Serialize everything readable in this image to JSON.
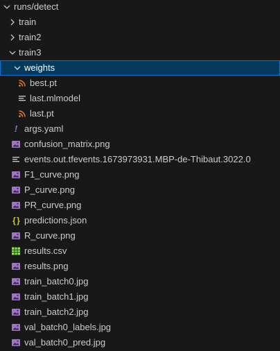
{
  "explorer": {
    "root": {
      "label": "runs/detect"
    },
    "folders": {
      "train": "train",
      "train2": "train2",
      "train3": "train3",
      "weights": "weights"
    },
    "weights_files": [
      {
        "label": "best.pt",
        "icon": "rss-icon"
      },
      {
        "label": "last.mlmodel",
        "icon": "lines-icon"
      },
      {
        "label": "last.pt",
        "icon": "rss-icon"
      }
    ],
    "files": [
      {
        "label": "args.yaml",
        "icon": "exclamation-icon"
      },
      {
        "label": "confusion_matrix.png",
        "icon": "image-icon"
      },
      {
        "label": "events.out.tfevents.1673973931.MBP-de-Thibaut.3022.0",
        "icon": "lines-icon"
      },
      {
        "label": "F1_curve.png",
        "icon": "image-icon"
      },
      {
        "label": "P_curve.png",
        "icon": "image-icon"
      },
      {
        "label": "PR_curve.png",
        "icon": "image-icon"
      },
      {
        "label": "predictions.json",
        "icon": "braces-icon"
      },
      {
        "label": "R_curve.png",
        "icon": "image-icon"
      },
      {
        "label": "results.csv",
        "icon": "table-icon"
      },
      {
        "label": "results.png",
        "icon": "image-icon"
      },
      {
        "label": "train_batch0.jpg",
        "icon": "image-icon"
      },
      {
        "label": "train_batch1.jpg",
        "icon": "image-icon"
      },
      {
        "label": "train_batch2.jpg",
        "icon": "image-icon"
      },
      {
        "label": "val_batch0_labels.jpg",
        "icon": "image-icon"
      },
      {
        "label": "val_batch0_pred.jpg",
        "icon": "image-icon"
      }
    ]
  },
  "colors": {
    "background": "#181818",
    "selected_bg": "#04395e",
    "selected_border": "#0078d4",
    "rss_icon": "#e37933",
    "image_icon": "#a074c4",
    "yaml_icon": "#a074c4",
    "json_icon": "#cbcb41",
    "csv_icon": "#89e051",
    "text": "#cccccc"
  }
}
